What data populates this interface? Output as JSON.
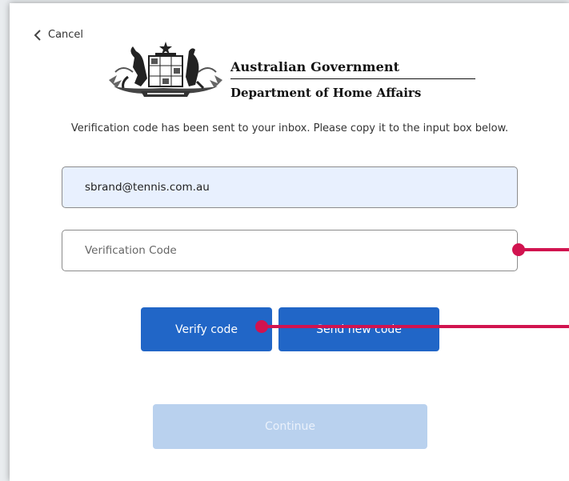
{
  "nav": {
    "cancel_label": "Cancel"
  },
  "header": {
    "gov_line1": "Australian Government",
    "gov_line2": "Department of Home Affairs"
  },
  "intro_text": "Verification code has been sent to your inbox. Please copy it to the input box below.",
  "form": {
    "email_value": "sbrand@tennis.com.au",
    "code_placeholder": "Verification Code",
    "verify_label": "Verify code",
    "send_label": "Send new code",
    "continue_label": "Continue"
  },
  "colors": {
    "primary_button": "#2166c7",
    "disabled_button": "#b9d1ee",
    "annotation": "#d1134f",
    "autofill_background": "#e8f0fe"
  },
  "icons": [
    "chevron-left-icon",
    "coat-of-arms-logo"
  ]
}
